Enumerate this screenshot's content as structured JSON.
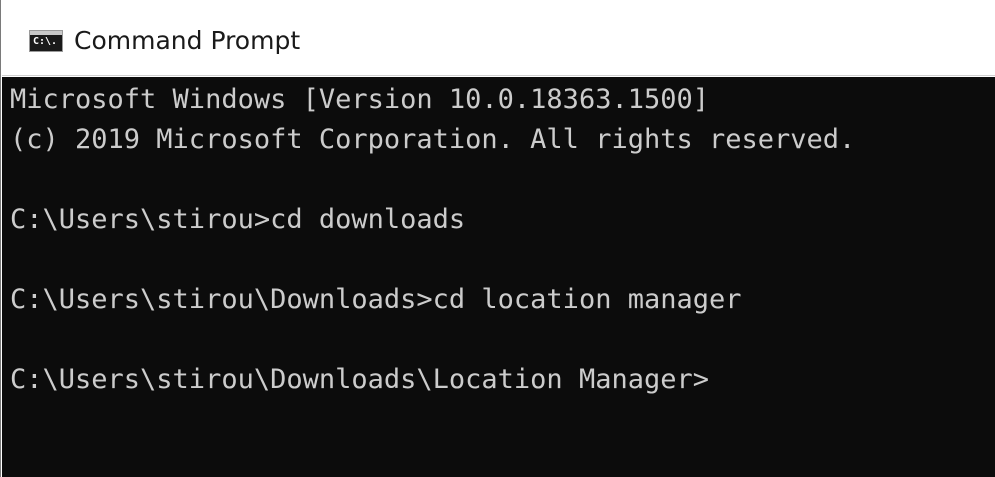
{
  "window": {
    "title": "Command Prompt",
    "icon": "cmd-icon",
    "icon_glyph": "C:\\."
  },
  "console": {
    "lines": [
      "Microsoft Windows [Version 10.0.18363.1500]",
      "(c) 2019 Microsoft Corporation. All rights reserved.",
      "C:\\Users\\stirou>cd downloads",
      "C:\\Users\\stirou\\Downloads>cd location manager",
      "C:\\Users\\stirou\\Downloads\\Location Manager>"
    ]
  },
  "colors": {
    "console_background": "#0c0c0c",
    "console_text": "#cccccc",
    "titlebar_background": "#ffffff"
  }
}
